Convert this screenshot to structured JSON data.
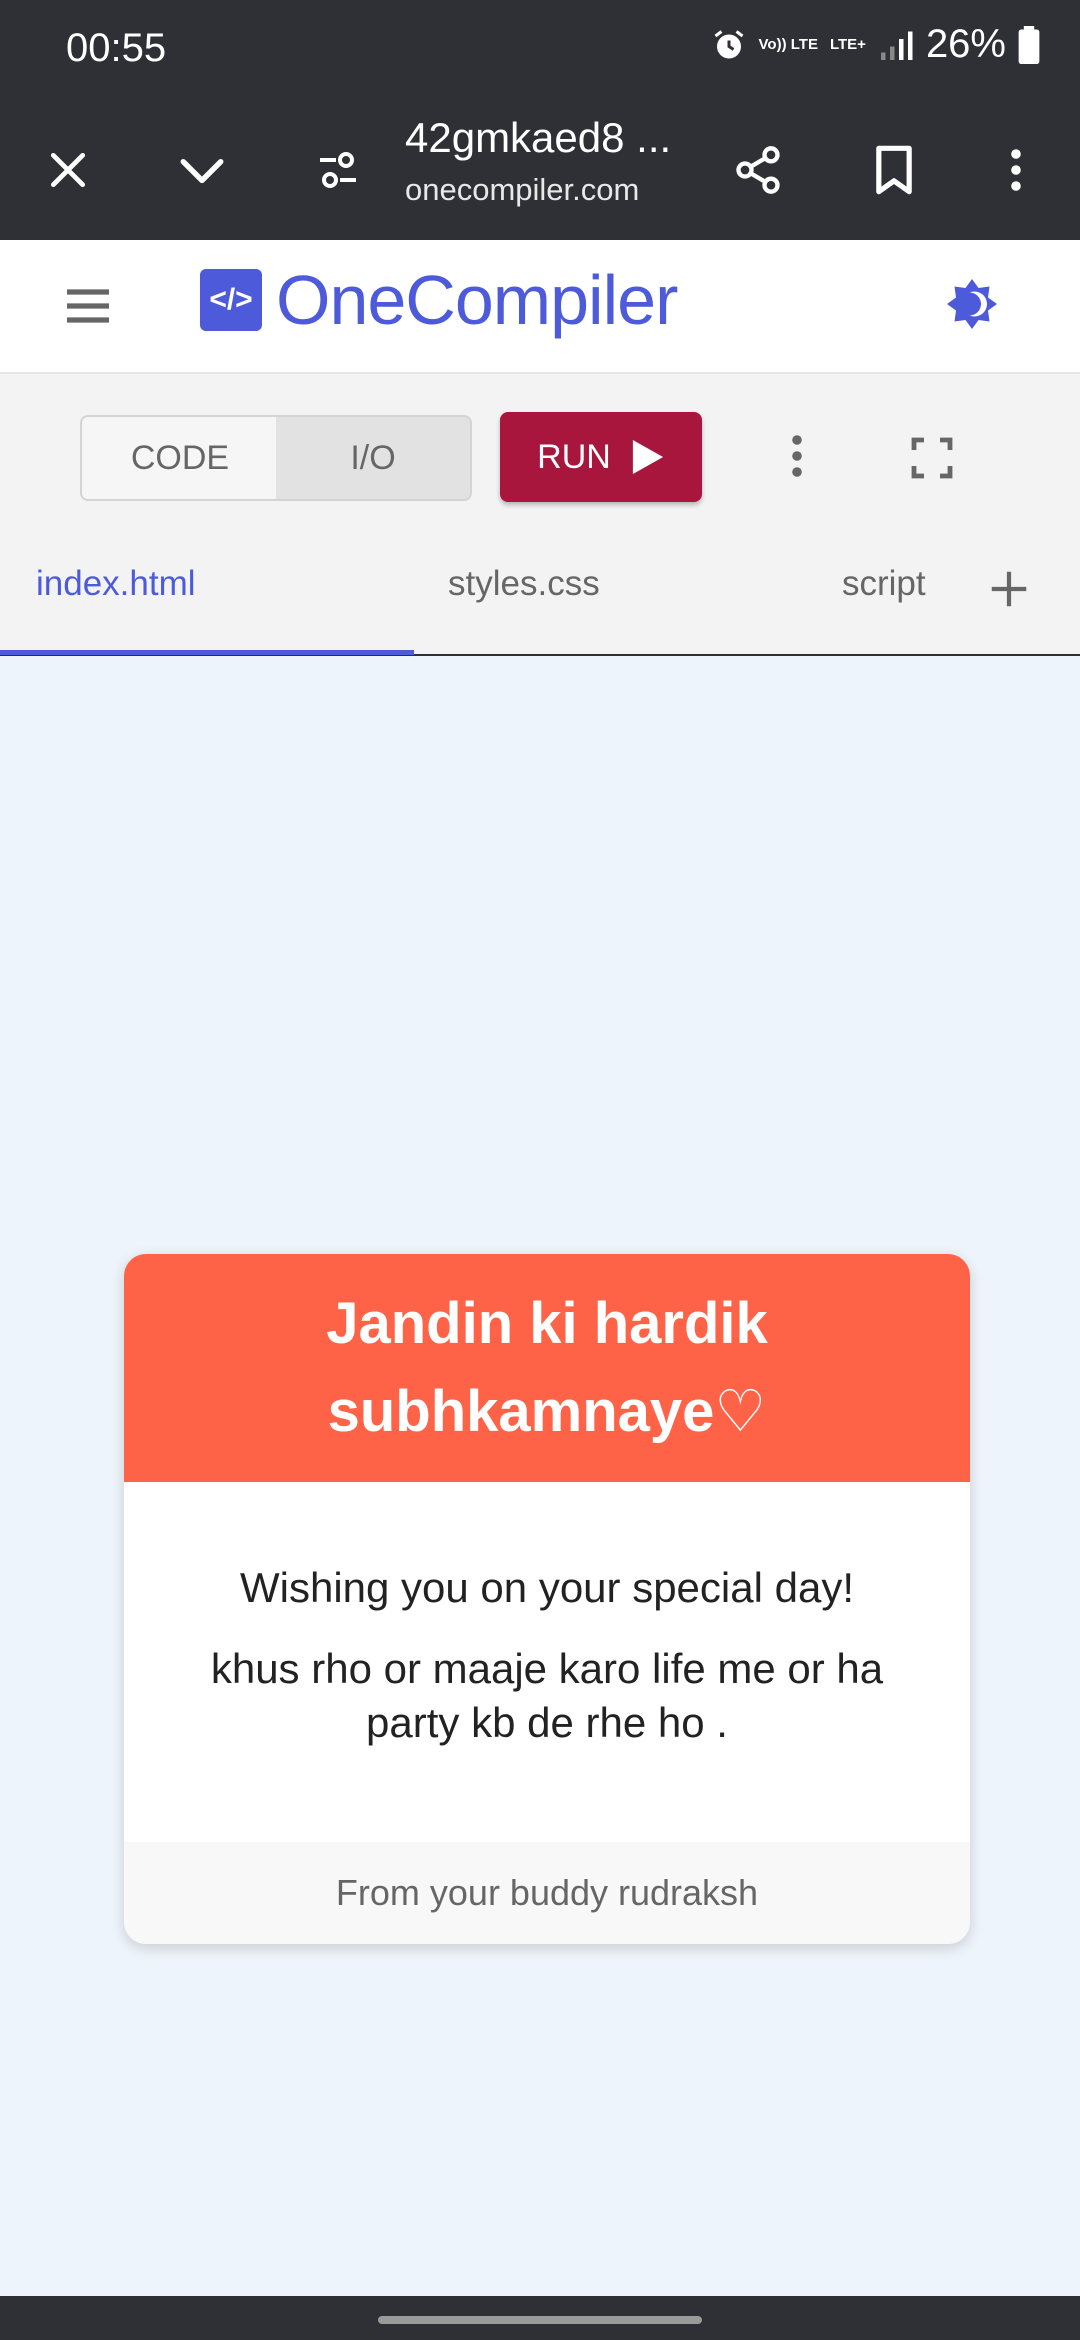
{
  "status_bar": {
    "time": "00:55",
    "volte_label": "Vo)) LTE",
    "lte_label": "LTE+",
    "battery": "26%",
    "icons": [
      "alarm-icon",
      "volte-icon",
      "lte-data-icon",
      "signal-icon",
      "battery-icon"
    ]
  },
  "browser": {
    "page_title": "42gmkaed8 ...",
    "domain": "onecompiler.com",
    "icons": [
      "close-icon",
      "chevron-down-icon",
      "site-settings-icon",
      "share-icon",
      "bookmark-icon",
      "more-vert-icon"
    ]
  },
  "app": {
    "logo_mark": "</>",
    "name": "OneCompiler",
    "icons": [
      "hamburger-menu-icon",
      "theme-toggle-icon"
    ]
  },
  "toolbar": {
    "code_label": "CODE",
    "io_label": "I/O",
    "run_label": "RUN",
    "icons": [
      "play-icon",
      "more-vert-icon",
      "fullscreen-icon"
    ]
  },
  "tabs": [
    {
      "label": "index.html",
      "active": true
    },
    {
      "label": "styles.css",
      "active": false
    },
    {
      "label": "script",
      "active": false
    }
  ],
  "card": {
    "title_line1": "Jandin ki hardik",
    "title_line2": "subhkamnaye♡",
    "message1": "Wishing you on your special day!",
    "message2": "khus rho or maaje karo life me or ha party kb de rhe ho .",
    "footer": "From your buddy rudraksh"
  },
  "colors": {
    "accent": "#4d5bdb",
    "run_button": "#a8163e",
    "card_header": "#ff6347",
    "output_bg": "#eef4fb",
    "system_bar": "#2e3035"
  }
}
